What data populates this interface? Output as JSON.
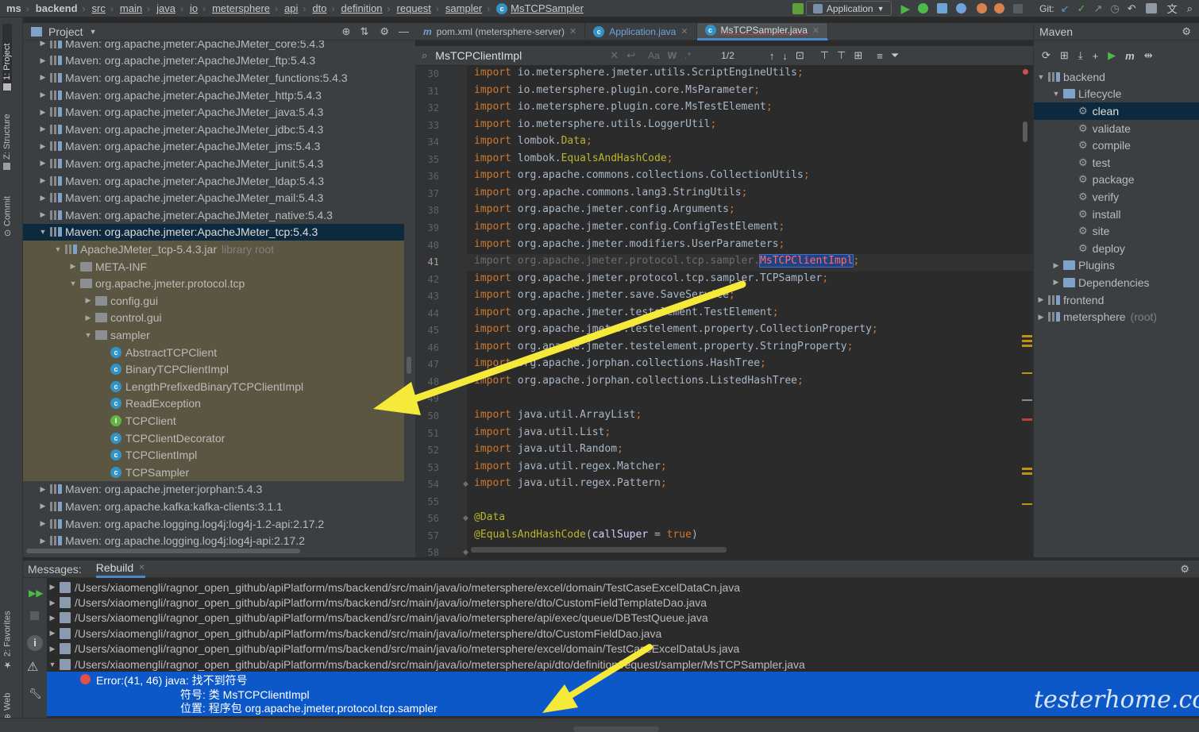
{
  "breadcrumbs": [
    "ms",
    "backend",
    "src",
    "main",
    "java",
    "io",
    "metersphere",
    "api",
    "dto",
    "definition",
    "request",
    "sampler",
    "MsTCPSampler"
  ],
  "toolbar": {
    "run_config": "Application",
    "git_label": "Git:"
  },
  "left_strip": {
    "project": "1: Project",
    "structure": "Z: Structure",
    "commit": "Commit",
    "favorites": "2: Favorites",
    "web": "Web"
  },
  "project": {
    "title": "Project",
    "rows": [
      {
        "text": "Maven: org.apache.jmeter:ApacheJMeter_core:5.4.3"
      },
      {
        "text": "Maven: org.apache.jmeter:ApacheJMeter_ftp:5.4.3"
      },
      {
        "text": "Maven: org.apache.jmeter:ApacheJMeter_functions:5.4.3"
      },
      {
        "text": "Maven: org.apache.jmeter:ApacheJMeter_http:5.4.3"
      },
      {
        "text": "Maven: org.apache.jmeter:ApacheJMeter_java:5.4.3"
      },
      {
        "text": "Maven: org.apache.jmeter:ApacheJMeter_jdbc:5.4.3"
      },
      {
        "text": "Maven: org.apache.jmeter:ApacheJMeter_jms:5.4.3"
      },
      {
        "text": "Maven: org.apache.jmeter:ApacheJMeter_junit:5.4.3"
      },
      {
        "text": "Maven: org.apache.jmeter:ApacheJMeter_ldap:5.4.3"
      },
      {
        "text": "Maven: org.apache.jmeter:ApacheJMeter_mail:5.4.3"
      },
      {
        "text": "Maven: org.apache.jmeter:ApacheJMeter_native:5.4.3"
      },
      {
        "text": "Maven: org.apache.jmeter:ApacheJMeter_tcp:5.4.3"
      },
      {
        "text": "ApacheJMeter_tcp-5.4.3.jar",
        "extra": "library root"
      },
      {
        "text": "META-INF"
      },
      {
        "text": "org.apache.jmeter.protocol.tcp"
      },
      {
        "text": "config.gui"
      },
      {
        "text": "control.gui"
      },
      {
        "text": "sampler"
      },
      {
        "text": "AbstractTCPClient"
      },
      {
        "text": "BinaryTCPClientImpl"
      },
      {
        "text": "LengthPrefixedBinaryTCPClientImpl"
      },
      {
        "text": "ReadException"
      },
      {
        "text": "TCPClient"
      },
      {
        "text": "TCPClientDecorator"
      },
      {
        "text": "TCPClientImpl"
      },
      {
        "text": "TCPSampler"
      },
      {
        "text": "Maven: org.apache.jmeter:jorphan:5.4.3"
      },
      {
        "text": "Maven: org.apache.kafka:kafka-clients:3.1.1"
      },
      {
        "text": "Maven: org.apache.logging.log4j:log4j-1.2-api:2.17.2"
      },
      {
        "text": "Maven: org.apache.logging.log4j:log4j-api:2.17.2"
      }
    ]
  },
  "editor_tabs": [
    {
      "label": "pom.xml (metersphere-server)"
    },
    {
      "label": "Application.java"
    },
    {
      "label": "MsTCPSampler.java"
    }
  ],
  "search": {
    "query": "MsTCPClientImpl",
    "match_case": "Aa",
    "words": "W",
    "regex": ".*",
    "count": "1/2"
  },
  "code": {
    "lines": [
      {
        "n": "30",
        "pkg": "io.metersphere.jmeter.utils.ScriptEngineUtils"
      },
      {
        "n": "31",
        "pkg": "io.metersphere.plugin.core.MsParameter"
      },
      {
        "n": "32",
        "pkg": "io.metersphere.plugin.core.MsTestElement"
      },
      {
        "n": "33",
        "pkg": "io.metersphere.utils.LoggerUtil"
      },
      {
        "n": "34",
        "pkg": "lombok.",
        "cls": "Data"
      },
      {
        "n": "35",
        "pkg": "lombok.",
        "cls": "EqualsAndHashCode"
      },
      {
        "n": "36",
        "pkg": "org.apache.commons.collections.CollectionUtils"
      },
      {
        "n": "37",
        "pkg": "org.apache.commons.lang3.StringUtils"
      },
      {
        "n": "38",
        "pkg": "org.apache.jmeter.config.Arguments"
      },
      {
        "n": "39",
        "pkg": "org.apache.jmeter.config.ConfigTestElement"
      },
      {
        "n": "40",
        "pkg": "org.apache.jmeter.modifiers.UserParameters"
      },
      {
        "n": "41",
        "pkg": "org.apache.jmeter.protocol.tcp.sampler.",
        "err": "MsTCPClientImpl"
      },
      {
        "n": "42",
        "pkg": "org.apache.jmeter.protocol.tcp.sampler.TCPSampler"
      },
      {
        "n": "43",
        "pkg": "org.apache.jmeter.save.SaveService"
      },
      {
        "n": "44",
        "pkg": "org.apache.jmeter.testelement.TestElement"
      },
      {
        "n": "45",
        "pkg": "org.apache.jmeter.testelement.property.CollectionProperty"
      },
      {
        "n": "46",
        "pkg": "org.apache.jmeter.testelement.property.StringProperty"
      },
      {
        "n": "47",
        "pkg": "org.apache.jorphan.collections.HashTree"
      },
      {
        "n": "48",
        "pkg": "org.apache.jorphan.collections.ListedHashTree"
      },
      {
        "n": "49"
      },
      {
        "n": "50",
        "pkg": "java.util.ArrayList"
      },
      {
        "n": "51",
        "pkg": "java.util.List"
      },
      {
        "n": "52",
        "pkg": "java.util.Random"
      },
      {
        "n": "53",
        "pkg": "java.util.regex.Matcher"
      },
      {
        "n": "54",
        "pkg": "java.util.regex.Pattern"
      },
      {
        "n": "55"
      },
      {
        "n": "56",
        "ann": "@Data"
      },
      {
        "n": "57",
        "ann": "@EqualsAndHashCode",
        "args": "callSuper = true"
      },
      {
        "n": "58"
      }
    ],
    "kw_import": "import"
  },
  "maven": {
    "title": "Maven",
    "rows": [
      {
        "text": "backend"
      },
      {
        "text": "Lifecycle"
      },
      {
        "text": "clean"
      },
      {
        "text": "validate"
      },
      {
        "text": "compile"
      },
      {
        "text": "test"
      },
      {
        "text": "package"
      },
      {
        "text": "verify"
      },
      {
        "text": "install"
      },
      {
        "text": "site"
      },
      {
        "text": "deploy"
      },
      {
        "text": "Plugins"
      },
      {
        "text": "Dependencies"
      },
      {
        "text": "frontend"
      },
      {
        "text": "metersphere",
        "extra": "(root)"
      }
    ]
  },
  "messages": {
    "label": "Messages:",
    "tab": "Rebuild",
    "files": [
      "/Users/xiaomengli/ragnor_open_github/apiPlatform/ms/backend/src/main/java/io/metersphere/excel/domain/TestCaseExcelDataCn.java",
      "/Users/xiaomengli/ragnor_open_github/apiPlatform/ms/backend/src/main/java/io/metersphere/dto/CustomFieldTemplateDao.java",
      "/Users/xiaomengli/ragnor_open_github/apiPlatform/ms/backend/src/main/java/io/metersphere/api/exec/queue/DBTestQueue.java",
      "/Users/xiaomengli/ragnor_open_github/apiPlatform/ms/backend/src/main/java/io/metersphere/dto/CustomFieldDao.java",
      "/Users/xiaomengli/ragnor_open_github/apiPlatform/ms/backend/src/main/java/io/metersphere/excel/domain/TestCaseExcelDataUs.java",
      "/Users/xiaomengli/ragnor_open_github/apiPlatform/ms/backend/src/main/java/io/metersphere/api/dto/definition/request/sampler/MsTCPSampler.java"
    ],
    "error_title": "Error:(41, 46)  java: 找不到符号",
    "error_symbol": "符号:   类 MsTCPClientImpl",
    "error_location": "位置: 程序包 org.apache.jmeter.protocol.tcp.sampler"
  },
  "watermark": "testerhome.com",
  "colors": {
    "accent": "#4a88c7",
    "selection": "#0d293e",
    "error_bg": "#0d58c8",
    "arrow": "#f5e93a"
  }
}
